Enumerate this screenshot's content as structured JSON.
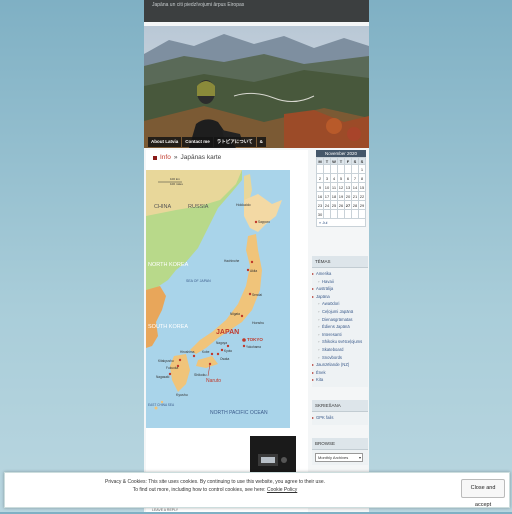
{
  "site": {
    "tagline": "Japāna un citi piedzīvojumi ārpus Eiropas"
  },
  "nav": {
    "items": [
      "About Latvia",
      "Contact me",
      "ラトビアについて",
      "&"
    ]
  },
  "post": {
    "category": "Info",
    "separator": "»",
    "title": "Japānas karte"
  },
  "map": {
    "countries": [
      "CHINA",
      "RUSSIA",
      "NORTH KOREA",
      "SOUTH KOREA",
      "JAPAN"
    ],
    "seas": [
      "SEA OF JAPAN",
      "NORTH PACIFIC OCEAN",
      "EAST CHINA SEA"
    ],
    "islands": [
      "Hokkaido",
      "Honshu",
      "Shikoku",
      "Kyushu"
    ],
    "cities": [
      "Sapporo",
      "Hachinohe",
      "Akita",
      "Sendai",
      "Niigata",
      "TOKYO",
      "Yokohama",
      "Nagoya",
      "Kyoto",
      "Osaka",
      "Kobe",
      "Hiroshima",
      "Kitakyushu",
      "Fukuoka",
      "Nagasaki",
      "Naruto"
    ],
    "scale": [
      "100 km",
      "100 miles"
    ]
  },
  "calendar": {
    "month": "November 2020",
    "days": [
      "M",
      "T",
      "W",
      "T",
      "F",
      "S",
      "S"
    ],
    "weeks": [
      [
        "",
        "",
        "",
        "",
        "",
        "",
        "1"
      ],
      [
        "2",
        "3",
        "4",
        "5",
        "6",
        "7",
        "8"
      ],
      [
        "9",
        "10",
        "11",
        "12",
        "13",
        "14",
        "15"
      ],
      [
        "16",
        "17",
        "18",
        "19",
        "20",
        "21",
        "22"
      ],
      [
        "23",
        "24",
        "25",
        "26",
        "27",
        "28",
        "29"
      ],
      [
        "30",
        "",
        "",
        "",
        "",
        "",
        ""
      ]
    ],
    "prev": "« Jul"
  },
  "topics": {
    "title": "TĒMAS",
    "items": [
      {
        "label": "Amerika",
        "sub": false
      },
      {
        "label": "Havaii",
        "sub": true
      },
      {
        "label": "Austrālija",
        "sub": false
      },
      {
        "label": "Japāna",
        "sub": false
      },
      {
        "label": "Awa0dori",
        "sub": true
      },
      {
        "label": "Ceļojumi Japānā",
        "sub": true
      },
      {
        "label": "Dienasgrāmatas",
        "sub": true
      },
      {
        "label": "Ēdiens Japānā",
        "sub": true
      },
      {
        "label": "Interesanti",
        "sub": true
      },
      {
        "label": "Shikoku svētceļojums",
        "sub": true
      },
      {
        "label": "Skateboard",
        "sub": true
      },
      {
        "label": "Snovbords",
        "sub": true
      },
      {
        "label": "Jaunzēlande (NZ)",
        "sub": false
      },
      {
        "label": "Ēnek",
        "sub": false
      },
      {
        "label": "Kita",
        "sub": false
      }
    ]
  },
  "skriesana": {
    "title": "SKRIEŠANA",
    "items": [
      "GPK fails"
    ]
  },
  "browse": {
    "title": "BROWSE",
    "select_value": "Monthly Archives"
  },
  "cookie": {
    "line1": "Privacy & Cookies: This site uses cookies. By continuing to use this website, you agree to their use.",
    "line2_prefix": "To find out more, including how to control cookies, see here: ",
    "link": "Cookie Policy",
    "button": "Close and accept"
  },
  "footer": {
    "text": "LEAVE A REPLY"
  }
}
